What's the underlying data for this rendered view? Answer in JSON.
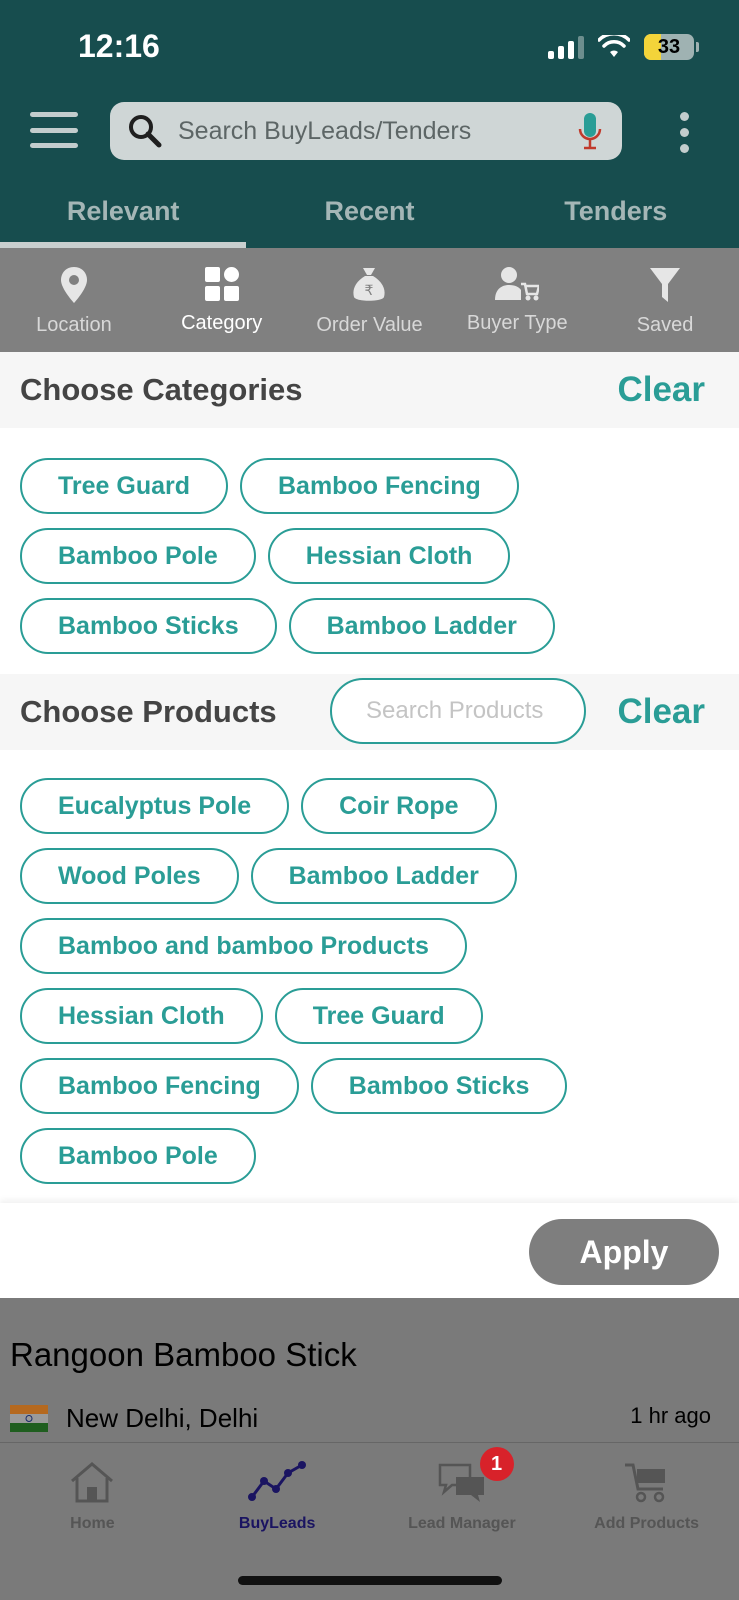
{
  "status_bar": {
    "time": "12:16",
    "battery": "33"
  },
  "search": {
    "placeholder": "Search BuyLeads/Tenders"
  },
  "tabs": [
    {
      "label": "Relevant",
      "active": true
    },
    {
      "label": "Recent",
      "active": false
    },
    {
      "label": "Tenders",
      "active": false
    }
  ],
  "filters": [
    {
      "label": "Location",
      "icon": "location-pin-icon",
      "active": false
    },
    {
      "label": "Category",
      "icon": "grid-icon",
      "active": true
    },
    {
      "label": "Order Value",
      "icon": "money-bag-icon",
      "active": false
    },
    {
      "label": "Buyer Type",
      "icon": "buyer-icon",
      "active": false
    },
    {
      "label": "Saved",
      "icon": "funnel-icon",
      "active": false
    }
  ],
  "categories": {
    "title": "Choose Categories",
    "clear_label": "Clear",
    "items": [
      "Tree Guard",
      "Bamboo Fencing",
      "Bamboo Pole",
      "Hessian Cloth",
      "Bamboo Sticks",
      "Bamboo Ladder"
    ]
  },
  "products": {
    "title": "Choose Products",
    "search_placeholder": "Search Products",
    "clear_label": "Clear",
    "items": [
      "Eucalyptus Pole",
      "Coir Rope",
      "Wood Poles",
      "Bamboo Ladder",
      "Bamboo and bamboo Products",
      "Hessian Cloth",
      "Tree Guard",
      "Bamboo Fencing",
      "Bamboo Sticks",
      "Bamboo Pole"
    ]
  },
  "apply_label": "Apply",
  "lead": {
    "title": "Rangoon Bamboo Stick",
    "location": "New Delhi, Delhi",
    "time": "1 hr ago"
  },
  "bottom_nav": [
    {
      "label": "Home",
      "icon": "home-icon",
      "active": false
    },
    {
      "label": "BuyLeads",
      "icon": "buyleads-graph-icon",
      "active": true
    },
    {
      "label": "Lead Manager",
      "icon": "chat-bubbles-icon",
      "active": false,
      "badge": "1"
    },
    {
      "label": "Add Products",
      "icon": "cart-icon",
      "active": false
    }
  ],
  "colors": {
    "header": "#174d4e",
    "accent": "#2a9d96",
    "filter_bar": "#808080",
    "badge": "#d8222a"
  }
}
